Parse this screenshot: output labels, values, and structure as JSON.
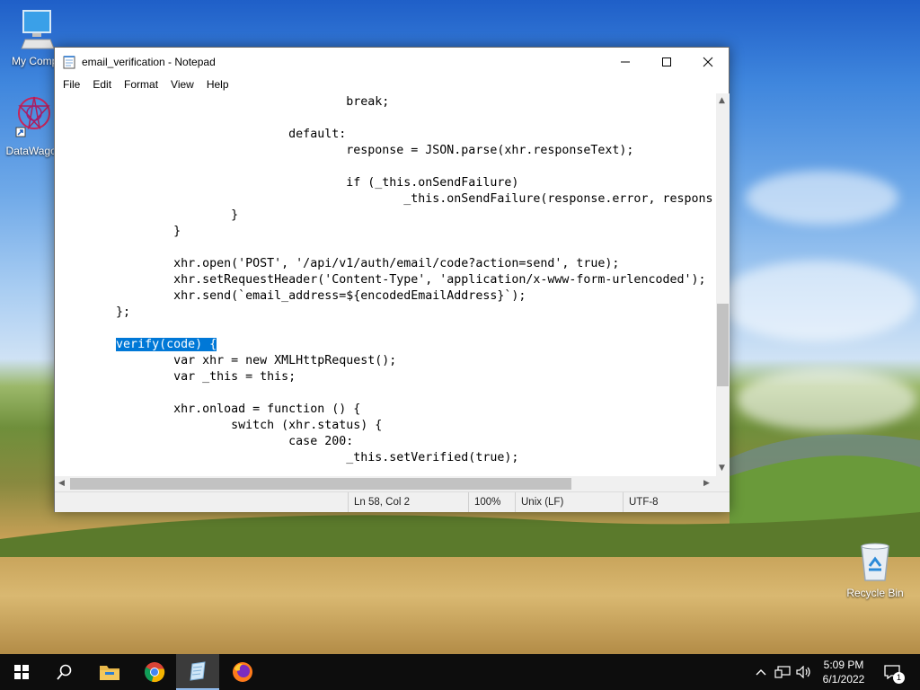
{
  "desktop": {
    "icons": [
      {
        "label": "My Compu"
      },
      {
        "label": "DataWagon"
      },
      {
        "label": "Recycle Bin"
      }
    ]
  },
  "window": {
    "title": "email_verification - Notepad",
    "menu": [
      "File",
      "Edit",
      "Format",
      "View",
      "Help"
    ],
    "code_lines": [
      "                                        break;",
      "",
      "                                default:",
      "                                        response = JSON.parse(xhr.responseText);",
      "",
      "                                        if (_this.onSendFailure)",
      "                                                _this.onSendFailure(response.error, respons",
      "                        }",
      "                }",
      "",
      "                xhr.open('POST', '/api/v1/auth/email/code?action=send', true);",
      "                xhr.setRequestHeader('Content-Type', 'application/x-www-form-urlencoded');",
      "                xhr.send(`email_address=${encodedEmailAddress}`);",
      "        };",
      "",
      "        ",
      "                var xhr = new XMLHttpRequest();",
      "                var _this = this;",
      "",
      "                xhr.onload = function () {",
      "                        switch (xhr.status) {",
      "                                case 200:",
      "                                        _this.setVerified(true);"
    ],
    "selected_text": "verify(code) {",
    "selected_line_index": 15,
    "status": {
      "position": "Ln 58, Col 2",
      "zoom": "100%",
      "line_ending": "Unix (LF)",
      "encoding": "UTF-8"
    }
  },
  "taskbar": {
    "clock_time": "5:09 PM",
    "clock_date": "6/1/2022",
    "notification_count": "1",
    "apps": [
      "start-icon",
      "search-icon",
      "file-explorer-icon",
      "chrome-icon",
      "notepad-icon",
      "firefox-icon"
    ]
  }
}
